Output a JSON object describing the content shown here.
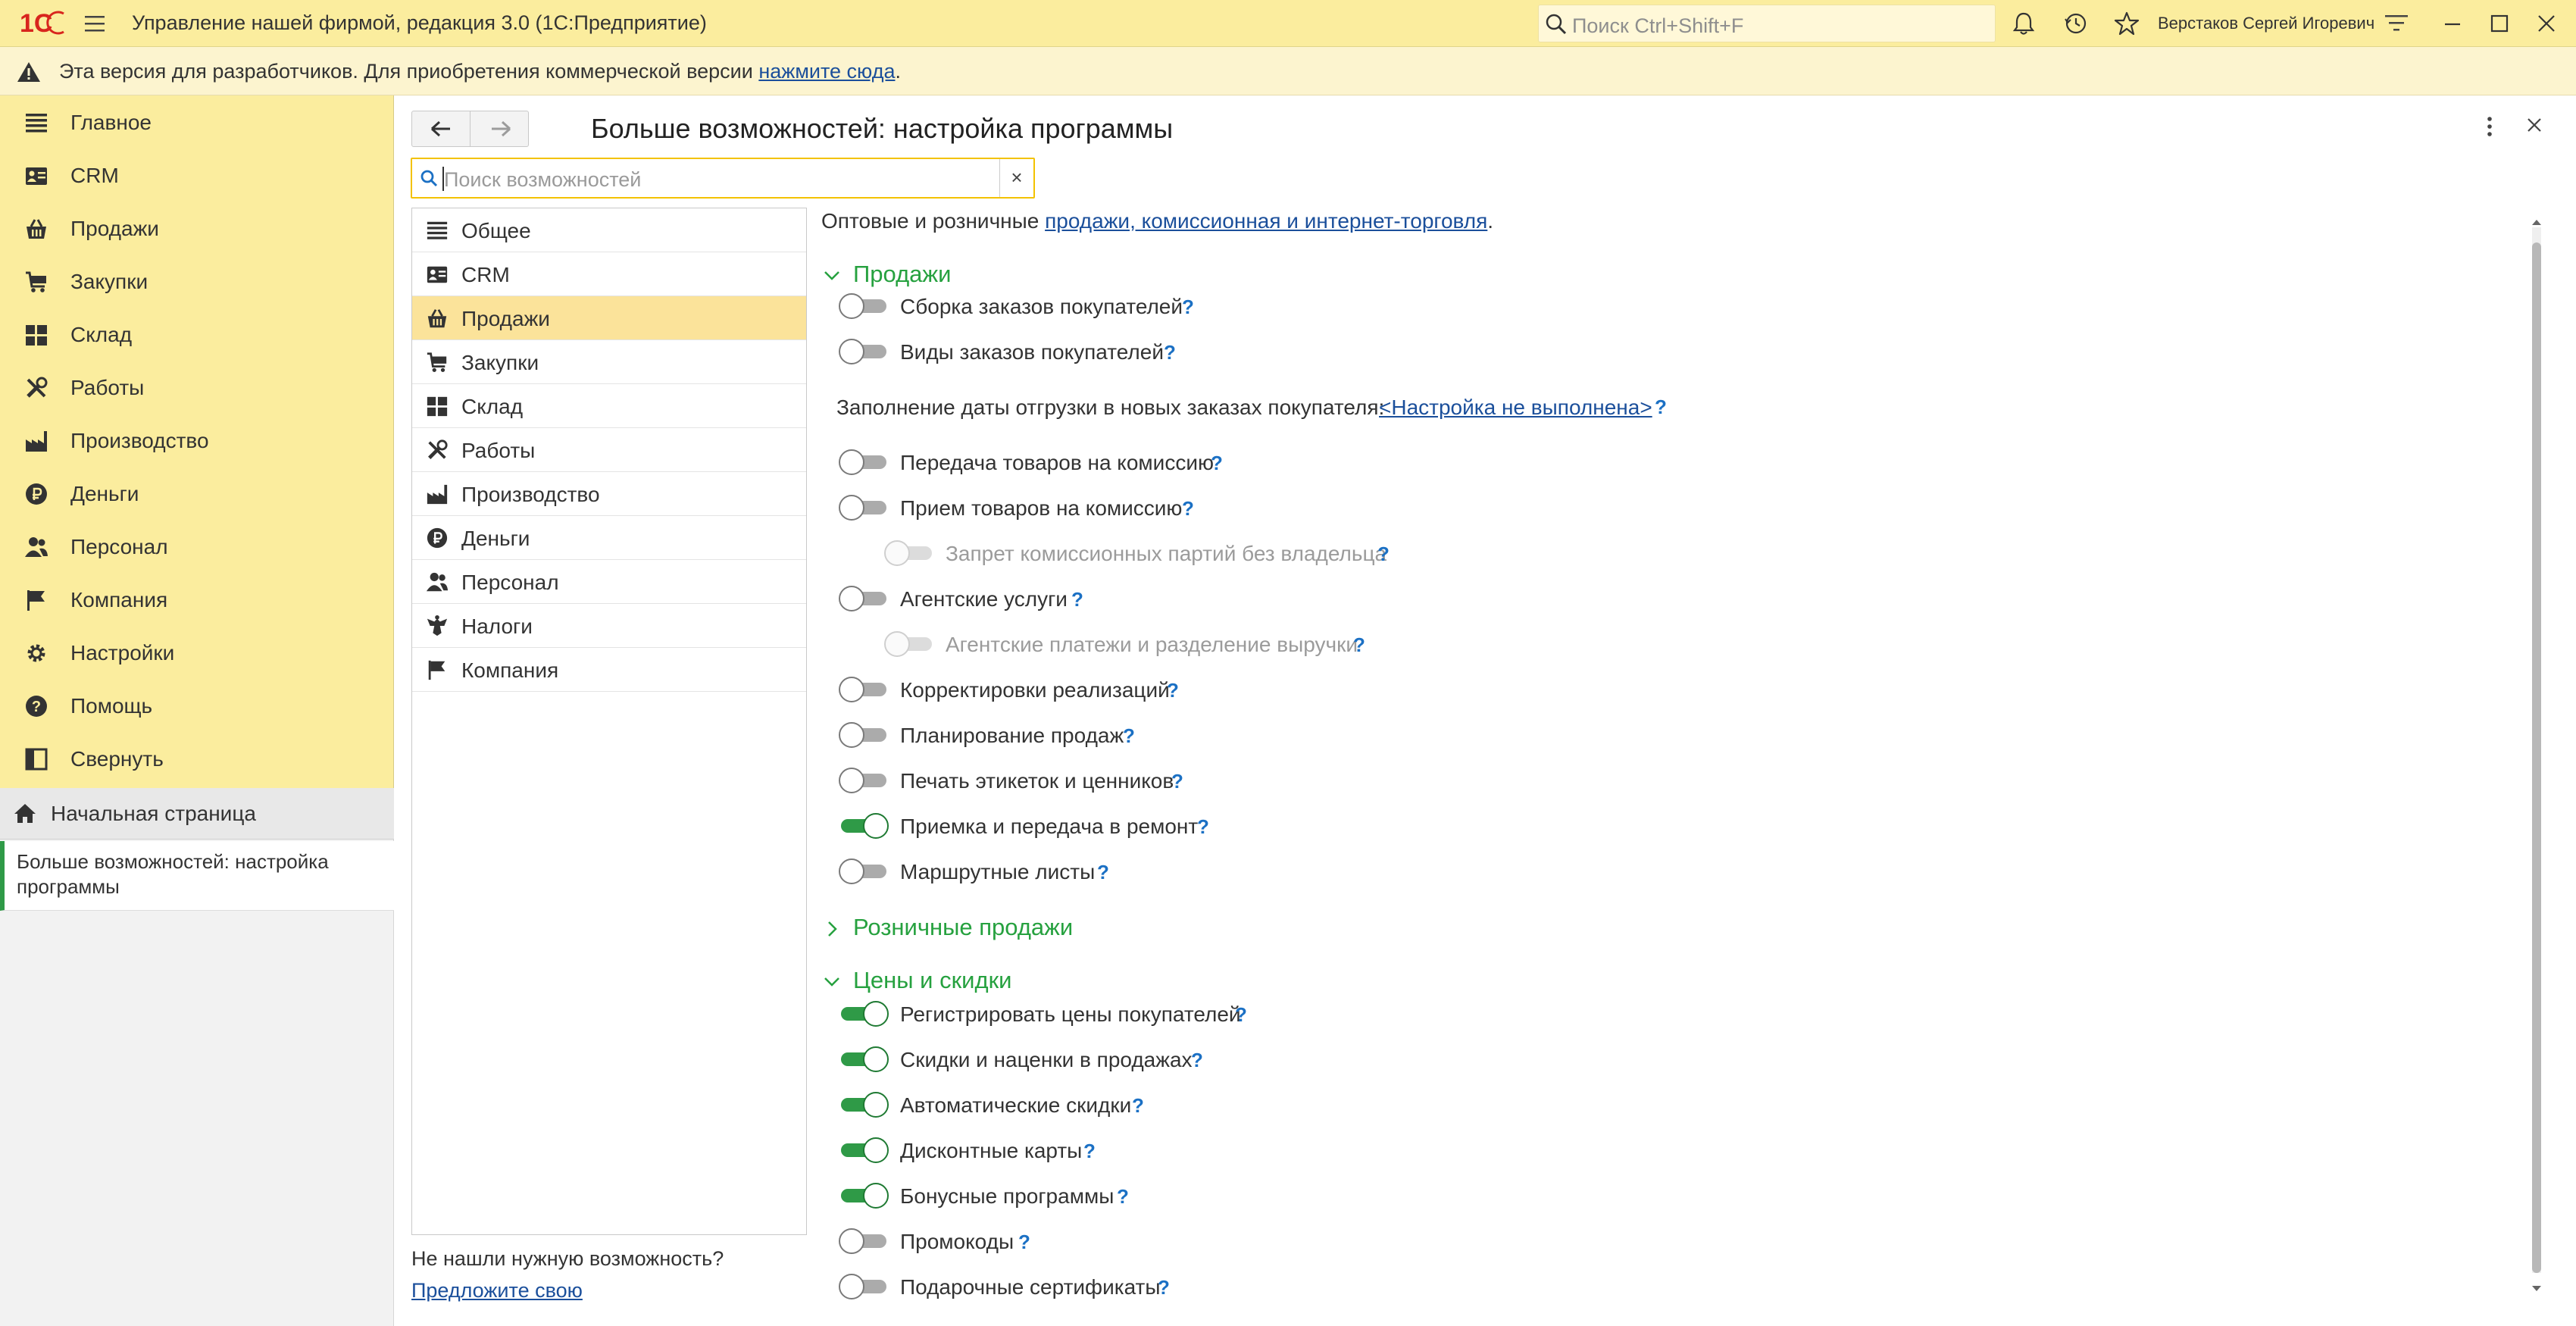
{
  "app": {
    "logo": "1С",
    "title": "Управление нашей фирмой, редакция 3.0  (1С:Предприятие)",
    "search_placeholder": "Поиск Ctrl+Shift+F",
    "user": "Верстаков Сергей Игоревич"
  },
  "warning": {
    "text": "Эта версия для разработчиков. Для приобретения коммерческой версии ",
    "link": "нажмите сюда",
    "after": "."
  },
  "sidebar": {
    "items": [
      {
        "label": "Главное",
        "icon": "menu-lines-icon"
      },
      {
        "label": "CRM",
        "icon": "contact-card-icon"
      },
      {
        "label": "Продажи",
        "icon": "basket-icon"
      },
      {
        "label": "Закупки",
        "icon": "cart-icon"
      },
      {
        "label": "Склад",
        "icon": "warehouse-grid-icon"
      },
      {
        "label": "Работы",
        "icon": "tools-icon"
      },
      {
        "label": "Производство",
        "icon": "factory-icon"
      },
      {
        "label": "Деньги",
        "icon": "ruble-coin-icon"
      },
      {
        "label": "Персонал",
        "icon": "people-icon"
      },
      {
        "label": "Компания",
        "icon": "flag-icon"
      },
      {
        "label": "Настройки",
        "icon": "gear-icon"
      },
      {
        "label": "Помощь",
        "icon": "question-circle-icon"
      },
      {
        "label": "Свернуть",
        "icon": "collapse-panel-icon"
      }
    ],
    "home": "Начальная страница",
    "open_window": "Больше возможностей: настройка программы"
  },
  "form": {
    "title": "Больше возможностей: настройка программы",
    "search_placeholder": "Поиск возможностей",
    "clear": "×",
    "not_found": "Не нашли нужную возможность?",
    "suggest": "Предложите свою"
  },
  "categories": [
    {
      "label": "Общее",
      "icon": "menu-lines-icon"
    },
    {
      "label": "CRM",
      "icon": "contact-card-icon"
    },
    {
      "label": "Продажи",
      "icon": "basket-icon",
      "selected": true
    },
    {
      "label": "Закупки",
      "icon": "cart-icon"
    },
    {
      "label": "Склад",
      "icon": "warehouse-grid-icon"
    },
    {
      "label": "Работы",
      "icon": "tools-icon"
    },
    {
      "label": "Производство",
      "icon": "factory-icon"
    },
    {
      "label": "Деньги",
      "icon": "ruble-coin-icon"
    },
    {
      "label": "Персонал",
      "icon": "people-icon"
    },
    {
      "label": "Налоги",
      "icon": "eagle-emblem-icon"
    },
    {
      "label": "Компания",
      "icon": "flag-icon"
    }
  ],
  "content": {
    "intro_text": "Оптовые и розничные ",
    "intro_link": "продажи, комиссионная и интернет-торговля",
    "intro_after": ".",
    "help_mark": "?",
    "sections": {
      "sales": "Продажи",
      "retail": "Розничные продажи",
      "prices": "Цены и скидки"
    },
    "shipment_label": "Заполнение даты отгрузки в новых заказах покупателя:",
    "shipment_link": "<Настройка не выполнена>",
    "sales_options": [
      {
        "label": "Сборка заказов покупателей",
        "on": false
      },
      {
        "label": "Виды заказов покупателей",
        "on": false
      },
      {
        "label": "Передача товаров на комиссию",
        "on": false
      },
      {
        "label": "Прием товаров на комиссию",
        "on": false
      },
      {
        "label": "Запрет комиссионных партий без владельца",
        "on": false,
        "disabled": true
      },
      {
        "label": "Агентские услуги",
        "on": false
      },
      {
        "label": "Агентские платежи и разделение выручки",
        "on": false,
        "disabled": true
      },
      {
        "label": "Корректировки реализаций",
        "on": false
      },
      {
        "label": "Планирование продаж",
        "on": false
      },
      {
        "label": "Печать этикеток и ценников",
        "on": false
      },
      {
        "label": "Приемка и передача в ремонт",
        "on": true
      },
      {
        "label": "Маршрутные листы",
        "on": false
      }
    ],
    "price_options": [
      {
        "label": "Регистрировать цены покупателей",
        "on": true
      },
      {
        "label": "Скидки и наценки в продажах",
        "on": true
      },
      {
        "label": "Автоматические скидки",
        "on": true
      },
      {
        "label": "Дисконтные карты",
        "on": true
      },
      {
        "label": "Бонусные программы",
        "on": true
      },
      {
        "label": "Промокоды",
        "on": false
      },
      {
        "label": "Подарочные сертификаты",
        "on": false
      }
    ]
  },
  "colors": {
    "accent_green": "#26a13f",
    "toggle_on": "#2f9a47",
    "panel_yellow": "#fbed9e",
    "link_blue": "#1b4f9b"
  }
}
